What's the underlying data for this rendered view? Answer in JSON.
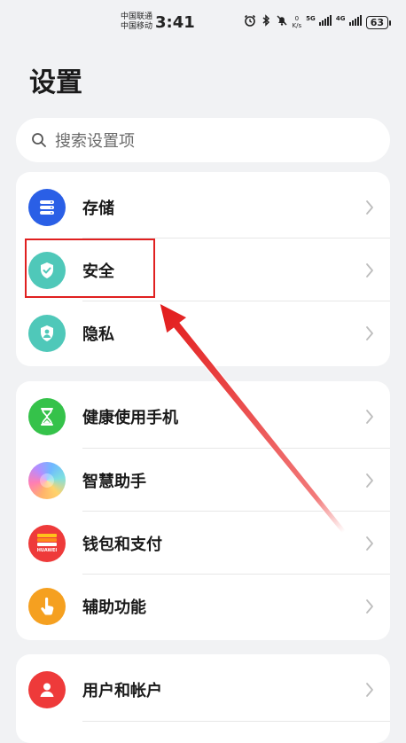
{
  "status_bar": {
    "carrier_1": "中国联通",
    "carrier_2": "中国移动",
    "time": "3:41",
    "net_speed_value": "0",
    "net_speed_unit": "K/s",
    "net_gen_1": "5G",
    "net_gen_2": "4G",
    "battery": "63"
  },
  "header": {
    "title": "设置"
  },
  "search": {
    "placeholder": "搜索设置项"
  },
  "groups": [
    {
      "items": [
        {
          "label": "存储",
          "icon": "storage-icon",
          "color": "#2a5fe6"
        },
        {
          "label": "安全",
          "icon": "shield-check-icon",
          "color": "#4fc8b9"
        },
        {
          "label": "隐私",
          "icon": "privacy-icon",
          "color": "#4fc8b9"
        }
      ]
    },
    {
      "items": [
        {
          "label": "健康使用手机",
          "icon": "hourglass-icon",
          "color": "#35c24a"
        },
        {
          "label": "智慧助手",
          "icon": "assistant-icon",
          "color": "#a68cf5"
        },
        {
          "label": "钱包和支付",
          "icon": "wallet-icon",
          "color": "#ee3a3a",
          "badge": "HUAWEI"
        },
        {
          "label": "辅助功能",
          "icon": "accessibility-hand-icon",
          "color": "#f5a020"
        }
      ]
    },
    {
      "items": [
        {
          "label": "用户和帐户",
          "icon": "user-icon",
          "color": "#ee3a3a"
        }
      ]
    }
  ],
  "annotation_color": "#e02020"
}
